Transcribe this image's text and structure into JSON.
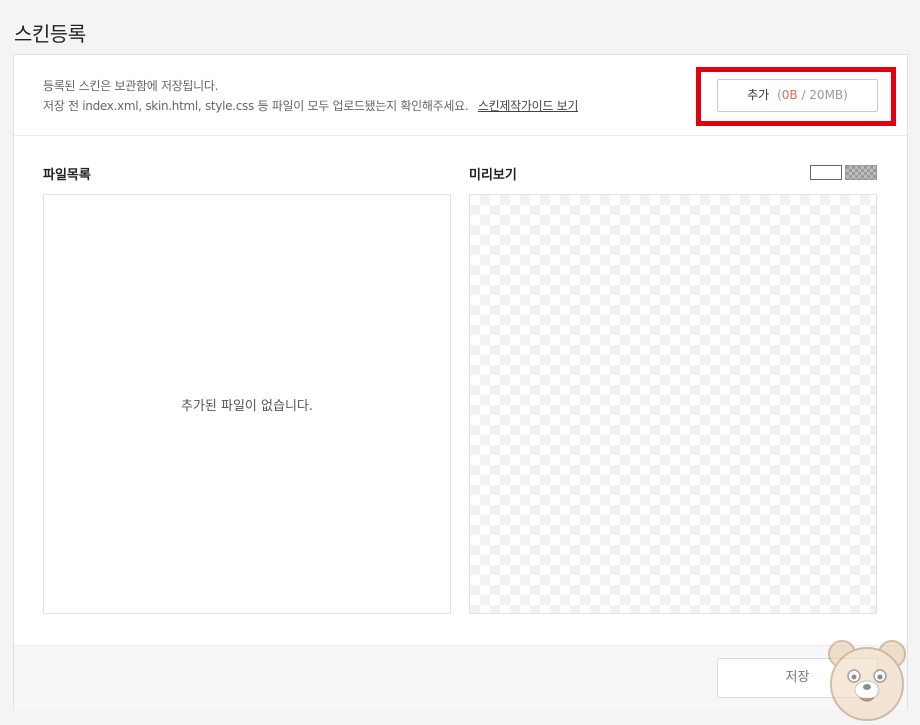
{
  "page": {
    "title": "스킨등록"
  },
  "info": {
    "line1": "등록된 스킨은 보관함에 저장됩니다.",
    "line2": "저장 전 index.xml, skin.html, style.css 등 파일이 모두 업로드됐는지 확인해주세요.",
    "guide_link": "스킨제작가이드 보기"
  },
  "add_button": {
    "label": "추가",
    "open_paren": "(",
    "used": "0B",
    "separator": " / ",
    "limit": "20MB",
    "close_paren": ")"
  },
  "files": {
    "label": "파일목록",
    "empty_message": "추가된 파일이 없습니다."
  },
  "preview": {
    "label": "미리보기",
    "toggles": [
      "white-background",
      "checkered-background"
    ]
  },
  "footer": {
    "save_label": "저장"
  },
  "colors": {
    "highlight_border": "#e3000f",
    "used_text": "#e66a4f"
  },
  "icons": [
    "bear-mascot-icon"
  ]
}
